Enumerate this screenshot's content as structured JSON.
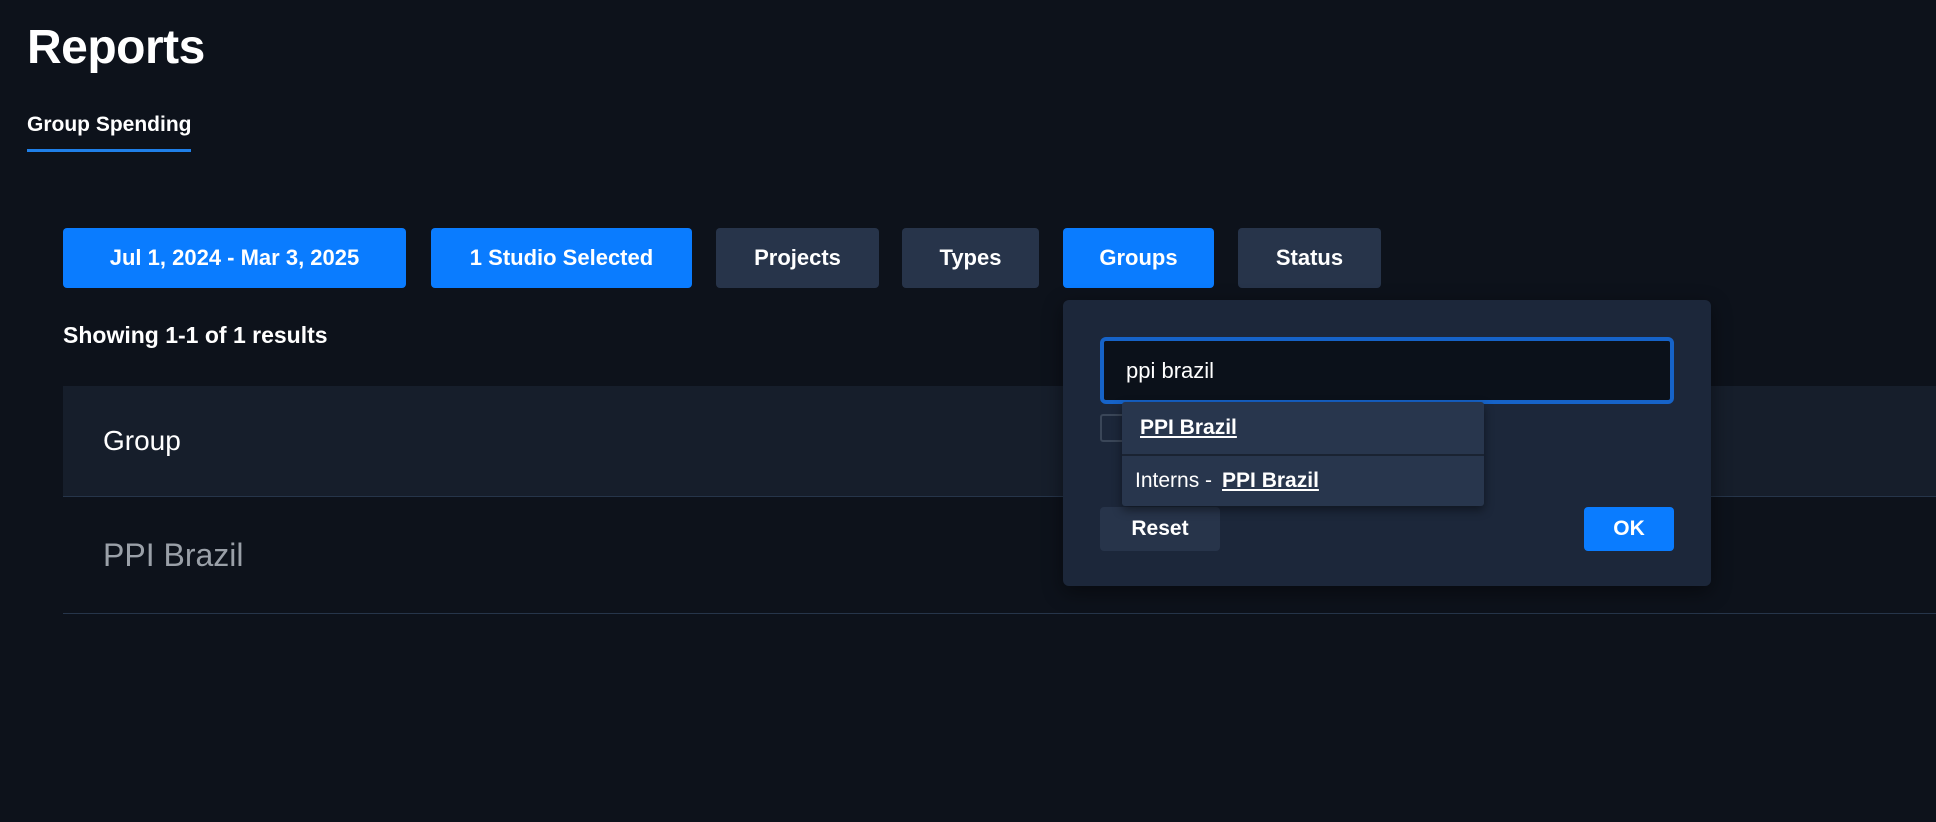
{
  "page": {
    "title": "Reports"
  },
  "tabs": [
    {
      "label": "Group Spending",
      "active": true
    }
  ],
  "filters": [
    {
      "label": "Jul 1, 2024 - Mar 3, 2025",
      "active": true
    },
    {
      "label": "1 Studio Selected",
      "active": true
    },
    {
      "label": "Projects",
      "active": false
    },
    {
      "label": "Types",
      "active": false
    },
    {
      "label": "Groups",
      "active": true
    },
    {
      "label": "Status",
      "active": false
    }
  ],
  "results": {
    "summary": "Showing 1-1 of 1 results"
  },
  "table": {
    "header": "Group",
    "rows": [
      {
        "group": "PPI Brazil"
      }
    ]
  },
  "groups_popover": {
    "search_value": "ppi brazil",
    "suggestions": [
      {
        "prefix": "",
        "match": "PPI Brazil"
      },
      {
        "prefix": "Interns -",
        "match": "PPI Brazil"
      }
    ],
    "reset_label": "Reset",
    "ok_label": "OK"
  },
  "colors": {
    "background": "#0d121b",
    "accent": "#0a7cff",
    "inactive_button": "#27344a",
    "popover": "#1c273a"
  }
}
